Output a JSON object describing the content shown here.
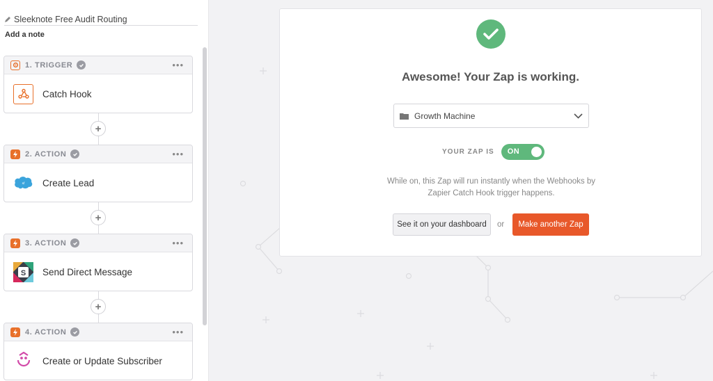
{
  "zap": {
    "title": "Sleeknote Free Audit Routing",
    "add_note": "Add a note"
  },
  "steps": [
    {
      "label": "1. TRIGGER",
      "app": "Catch Hook",
      "kind": "trigger",
      "icon": "webhook-icon"
    },
    {
      "label": "2. ACTION",
      "app": "Create Lead",
      "kind": "action",
      "icon": "salesforce-icon"
    },
    {
      "label": "3. ACTION",
      "app": "Send Direct Message",
      "kind": "action",
      "icon": "slack-icon"
    },
    {
      "label": "4. ACTION",
      "app": "Create or Update Subscriber",
      "kind": "action",
      "icon": "drip-icon"
    }
  ],
  "step_more": "•••",
  "connector_plus": "+",
  "card": {
    "headline": "Awesome! Your Zap is working.",
    "folder": "Growth Machine",
    "status_label": "YOUR ZAP IS",
    "toggle_label": "ON",
    "description": "While on, this Zap will run instantly when the Webhooks by Zapier Catch Hook trigger happens.",
    "dashboard_button": "See it on your dashboard",
    "or_text": "or",
    "make_button": "Make another Zap"
  },
  "colors": {
    "success_green": "#5fb87c",
    "accent_orange": "#e8582a",
    "step_orange": "#e8702a",
    "salesforce_blue": "#3ba4dc"
  }
}
